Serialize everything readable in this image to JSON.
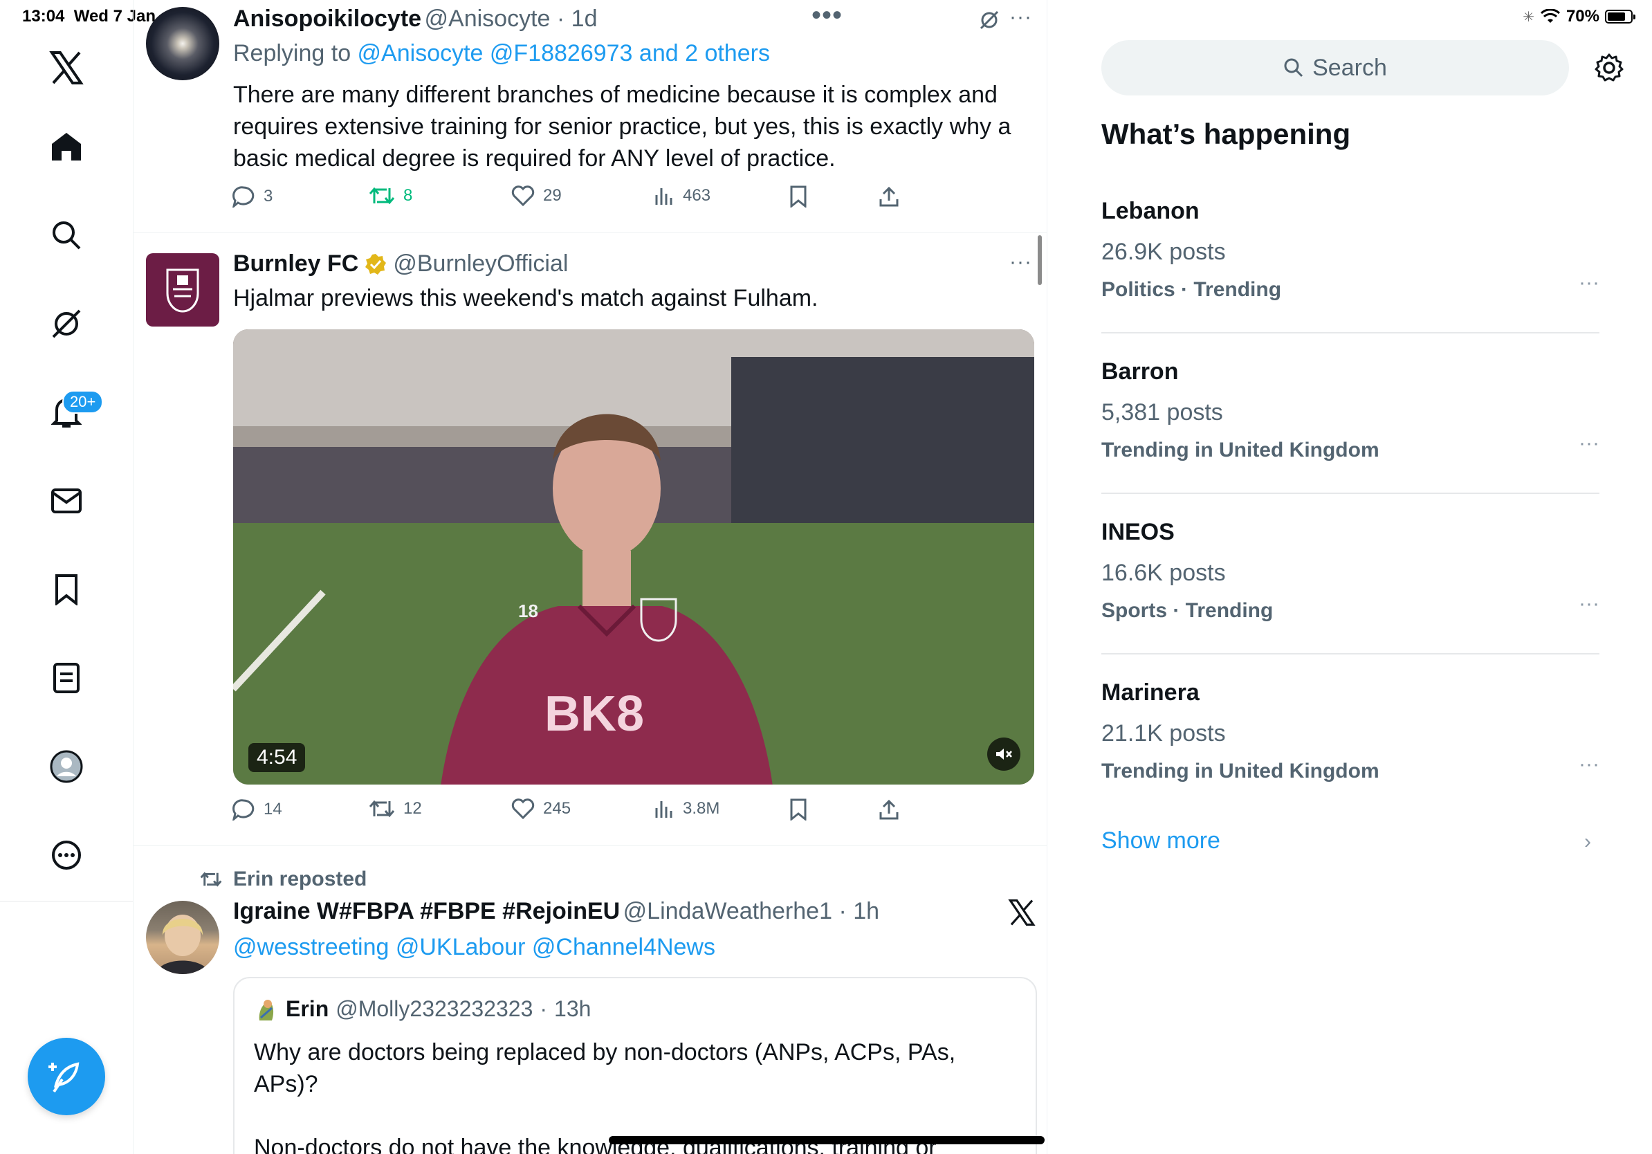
{
  "status": {
    "time": "13:04",
    "date": "Wed 7 Jan",
    "battery": "70%"
  },
  "sidebar": {
    "notifications_badge": "20+"
  },
  "tweets": [
    {
      "name": "Anisopoikilocyte",
      "handle": "@Anisocyte",
      "time": "1d",
      "replying_prefix": "Replying to ",
      "replying_to": "@Anisocyte @F18826973 and 2 others",
      "text": "There are many different branches of medicine because it is complex and requires extensive training for senior practice, but yes, this is exactly why a basic medical degree is required for ANY level of practice.",
      "replies": "3",
      "reposts": "8",
      "likes": "29",
      "views": "463"
    },
    {
      "name": "Burnley FC",
      "handle": "@BurnleyOfficial",
      "text": "Hjalmar previews this weekend's match against Fulham.",
      "video_duration": "4:54",
      "video_text": "BK8",
      "jersey_number": "18",
      "replies": "14",
      "reposts": "12",
      "likes": "245",
      "views": "3.8M"
    },
    {
      "reposted_by": "Erin reposted",
      "name": "Igraine W#FBPA #FBPE #RejoinEU",
      "handle": "@LindaWeatherhe1",
      "time": "1h",
      "text": "@wesstreeting @UKLabour @Channel4News",
      "quote": {
        "name": "Erin",
        "handle": "@Molly2323232323",
        "time": "13h",
        "text": "Why are doctors being replaced by non-doctors (ANPs, ACPs, PAs, APs)?",
        "text2": "Non-doctors do not have the knowledge, qualifications, training or"
      }
    }
  ],
  "right": {
    "search_placeholder": "Search",
    "heading": "What’s happening",
    "trends": [
      {
        "title": "Lebanon",
        "posts": "26.9K posts",
        "meta": "Politics · Trending"
      },
      {
        "title": "Barron",
        "posts": "5,381 posts",
        "meta": "Trending in United Kingdom"
      },
      {
        "title": "INEOS",
        "posts": "16.6K posts",
        "meta": "Sports · Trending"
      },
      {
        "title": "Marinera",
        "posts": "21.1K posts",
        "meta": "Trending in United Kingdom"
      }
    ],
    "show_more": "Show more"
  },
  "colors": {
    "accent": "#1d9bf0",
    "repost_green": "#00ba7c",
    "burnley_claret": "#6c1d45"
  }
}
